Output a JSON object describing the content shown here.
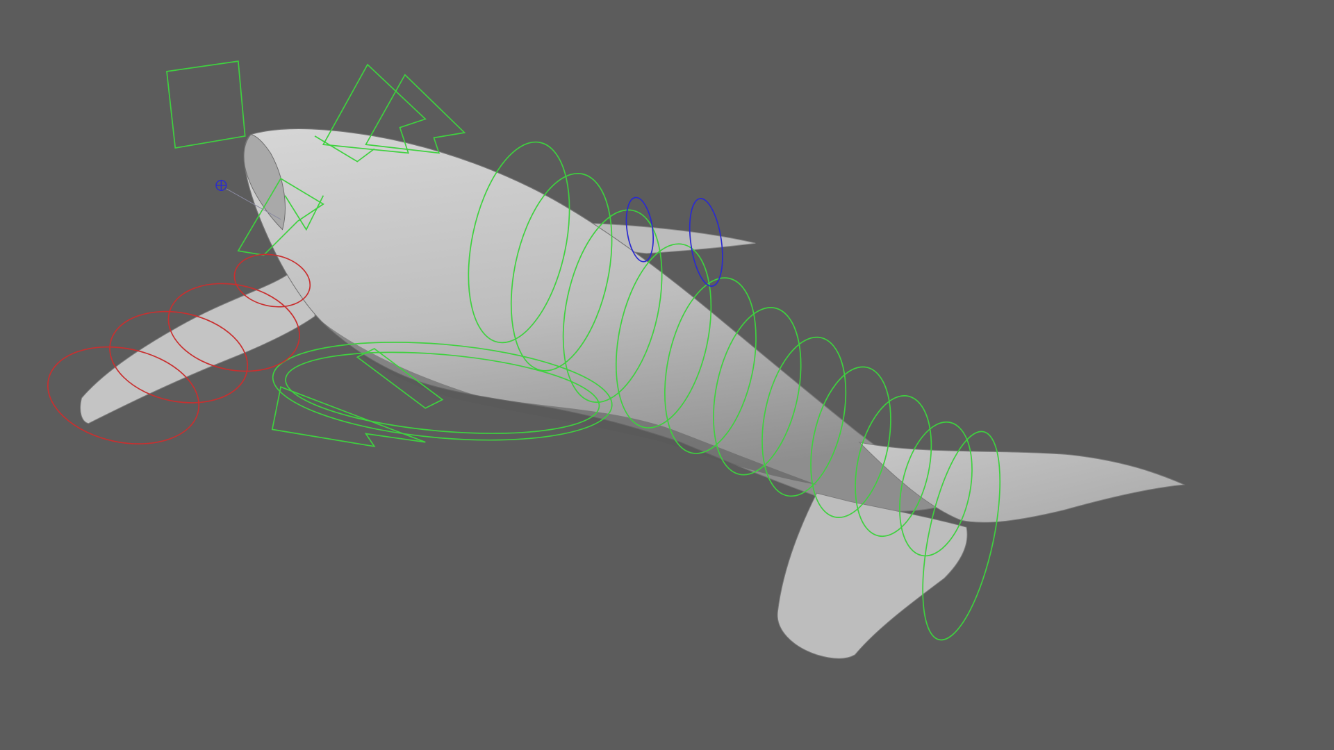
{
  "viewport": {
    "background_color": "#5c5c5c",
    "subject": "rigged-whale-mesh"
  },
  "colors": {
    "mesh_fill": "#b9b9b9",
    "mesh_light": "#d2d2d2",
    "mesh_shadow": "#7e7e7e",
    "fk_controls": "#3fd13f",
    "flipper_controls": "#c83030",
    "ik_controls": "#2a2ad0",
    "pole_vector": "#8a8aa0"
  },
  "icons": {
    "pole_vector_target": "crosshair-circle-icon"
  }
}
